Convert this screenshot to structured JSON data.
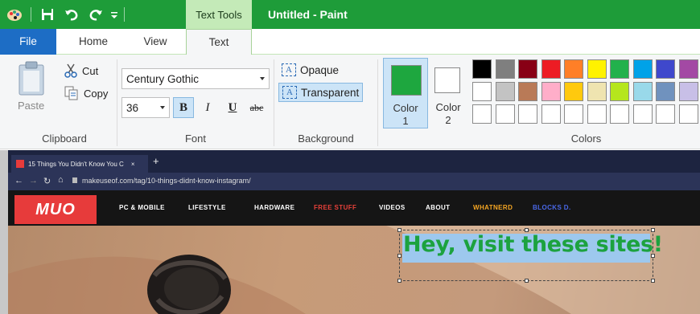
{
  "app": {
    "title": "Untitled - Paint",
    "contextual_tab": "Text Tools"
  },
  "tabs": {
    "file": "File",
    "home": "Home",
    "view": "View",
    "text": "Text"
  },
  "clipboard": {
    "paste": "Paste",
    "cut": "Cut",
    "copy": "Copy",
    "label": "Clipboard"
  },
  "font": {
    "family": "Century Gothic",
    "size": "36",
    "bold": "B",
    "italic": "I",
    "underline": "U",
    "strike": "abc",
    "label": "Font"
  },
  "background": {
    "opaque": "Opaque",
    "transparent": "Transparent",
    "icon_glyph": "A",
    "label": "Background",
    "selected": "transparent"
  },
  "colors": {
    "color1_label": "Color",
    "color1_num": "1",
    "color2_label": "Color",
    "color2_num": "2",
    "label": "Colors",
    "color1_value": "#1ea73f",
    "color2_value": "#ffffff",
    "palette_rows": [
      [
        "#000000",
        "#7f7f7f",
        "#880015",
        "#ed1c24",
        "#ff7f27",
        "#fff200",
        "#22b14c",
        "#00a2e8",
        "#3f48cc",
        "#a349a4"
      ],
      [
        "#ffffff",
        "#c3c3c3",
        "#b97a57",
        "#ffaec9",
        "#ffc90e",
        "#efe4b0",
        "#b5e61d",
        "#99d9ea",
        "#7092be",
        "#c8bfe7"
      ],
      [
        "#ffffff",
        "#ffffff",
        "#ffffff",
        "#ffffff",
        "#ffffff",
        "#ffffff",
        "#ffffff",
        "#ffffff",
        "#ffffff",
        "#ffffff"
      ]
    ]
  },
  "browser": {
    "tab_title": "15 Things You Didn't Know You C",
    "tab_close": "×",
    "new_tab": "+",
    "url": "makeuseof.com/tag/10-things-didnt-know-instagram/"
  },
  "site": {
    "logo": "MUO",
    "nav": [
      {
        "label": "PC & MOBILE",
        "color": "#ffffff"
      },
      {
        "label": "LIFESTYLE",
        "color": "#ffffff"
      },
      {
        "label": "HARDWARE",
        "color": "#ffffff"
      },
      {
        "label": "FREE STUFF",
        "color": "#e8413a"
      },
      {
        "label": "VIDEOS",
        "color": "#ffffff"
      },
      {
        "label": "ABOUT",
        "color": "#ffffff"
      },
      {
        "label": "WHATNERD",
        "color": "#f5a623"
      },
      {
        "label": "BLOCKS D.",
        "color": "#4a68e8"
      }
    ]
  },
  "overlay": {
    "text": "Hey, visit these sites!",
    "color": "#1ca23f"
  }
}
